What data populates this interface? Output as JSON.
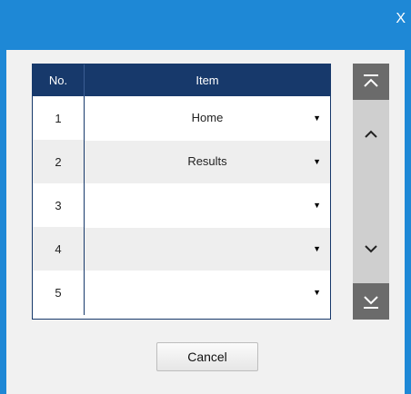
{
  "window": {
    "close_label": "X"
  },
  "table": {
    "headers": {
      "no": "No.",
      "item": "Item"
    },
    "rows": [
      {
        "no": "1",
        "item": "Home"
      },
      {
        "no": "2",
        "item": "Results"
      },
      {
        "no": "3",
        "item": ""
      },
      {
        "no": "4",
        "item": ""
      },
      {
        "no": "5",
        "item": ""
      }
    ]
  },
  "scroller": {
    "icons": [
      "scroll-top-icon",
      "scroll-up-icon",
      "scroll-down-icon",
      "scroll-bottom-icon"
    ]
  },
  "footer": {
    "cancel_label": "Cancel"
  },
  "colors": {
    "window_blue": "#1e88d6",
    "header_navy": "#17396b",
    "scroll_dark": "#6b6b6b",
    "scroll_track": "#cfcfcf"
  }
}
